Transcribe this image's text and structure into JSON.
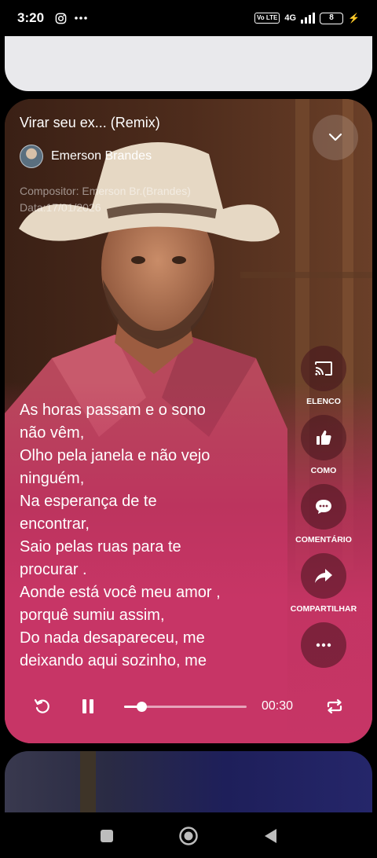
{
  "status_bar": {
    "time": "3:20",
    "left_icons": [
      "instagram-icon",
      "more-dots-icon"
    ],
    "volte": "Vo LTE",
    "network": "4G",
    "battery": "8"
  },
  "player": {
    "song_title": "Virar seu ex... (Remix)",
    "artist_name": "Emerson Brandes",
    "composer": "Compositor: Emerson Br.(Brandes)",
    "date": "Data:17/01/2026",
    "lyrics": [
      "As horas passam e o sono",
      "não vêm,",
      "Olho pela janela e não vejo",
      "ninguém,",
      "Na esperança de te",
      "encontrar,",
      "Saio pelas ruas para te",
      "procurar .",
      "Aonde está você meu amor ,",
      "porquê sumiu assim,",
      "Do nada desapareceu, me",
      "deixando aqui sozinho, me"
    ],
    "actions": [
      {
        "id": "cast",
        "label": "ELENCO",
        "icon": "cast-icon"
      },
      {
        "id": "like",
        "label": "COMO",
        "icon": "thumbs-up-icon"
      },
      {
        "id": "comment",
        "label": "COMENTÁRIO",
        "icon": "comment-icon"
      },
      {
        "id": "share",
        "label": "COMPARTILHAR",
        "icon": "share-icon"
      },
      {
        "id": "more",
        "label": "",
        "icon": "more-icon"
      }
    ],
    "controls": {
      "current_time": "00:30",
      "progress": 0.14
    }
  },
  "colors": {
    "accent_pink": "#c73566",
    "card_dark": "#3c2217"
  }
}
